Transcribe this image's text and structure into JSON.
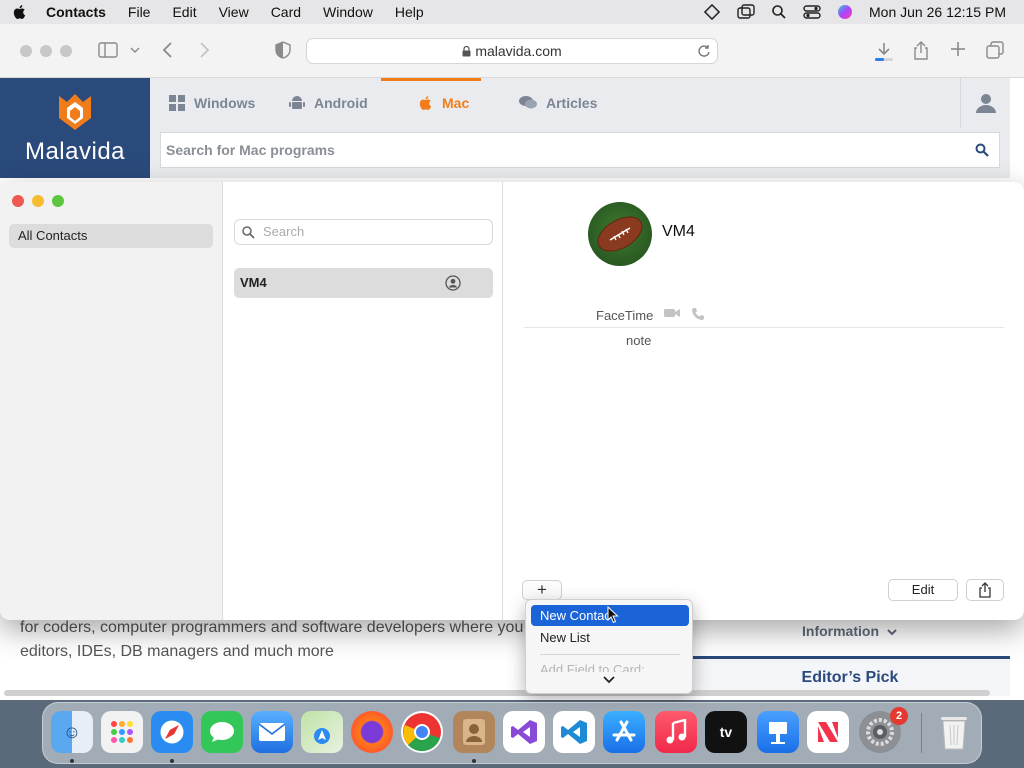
{
  "menubar": {
    "app_name": "Contacts",
    "menus": [
      "File",
      "Edit",
      "View",
      "Card",
      "Window",
      "Help"
    ],
    "clock": "Mon Jun 26  12:15 PM"
  },
  "safari": {
    "url": "malavida.com"
  },
  "site": {
    "logo_text": "Malavida",
    "nav": [
      {
        "label": "Windows",
        "icon": "windows-icon"
      },
      {
        "label": "Android",
        "icon": "android-icon"
      },
      {
        "label": "Mac",
        "icon": "apple-icon",
        "active": true
      },
      {
        "label": "Articles",
        "icon": "chat-icon"
      }
    ],
    "search_placeholder": "Search for Mac programs",
    "body_line1": "for coders, computer programmers and software developers where you",
    "body_line2": "editors, IDEs, DB managers and much more",
    "info_label": "Information",
    "editors_pick": "Editor’s Pick",
    "accent": "#f07d1a",
    "brand": "#2b4a7c"
  },
  "contacts": {
    "sidebar_item": "All Contacts",
    "search_placeholder": "Search",
    "list": [
      "VM4"
    ],
    "detail": {
      "name": "VM4",
      "facetime_label": "FaceTime",
      "note_label": "note"
    },
    "edit_label": "Edit",
    "add_label": "+"
  },
  "popup_menu": {
    "items": [
      "New Contact",
      "New List"
    ],
    "disabled_item": "Add Field to Card:",
    "highlighted": "New Contact"
  },
  "dock": {
    "apps": [
      "Finder",
      "Launchpad",
      "Safari",
      "Messages",
      "Mail",
      "Maps",
      "Firefox",
      "Chrome",
      "Contacts",
      "Visual Studio",
      "VS Code",
      "App Store",
      "Music",
      "Apple TV",
      "Keynote",
      "News",
      "System Settings",
      "Trash"
    ],
    "settings_badge": "2"
  }
}
